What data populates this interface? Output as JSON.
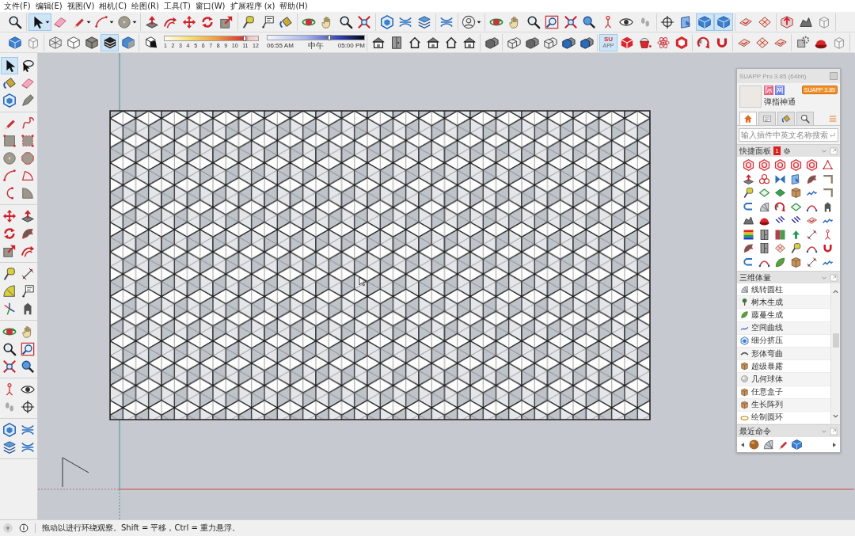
{
  "menu": [
    "文件(F)",
    "编辑(E)",
    "视图(V)",
    "相机(C)",
    "绘图(R)",
    "工具(T)",
    "窗口(W)",
    "扩展程序 (x)",
    "帮助(H)"
  ],
  "toolbar_1": [
    [
      {
        "kind": "magnifier",
        "selected": false
      }
    ],
    [
      {
        "kind": "cursor",
        "selected": true,
        "dropdown": true
      },
      {
        "kind": "eraser",
        "selected": false
      },
      {
        "kind": "pencil",
        "selected": false,
        "dropdown": true
      },
      {
        "kind": "arc",
        "selected": false,
        "dropdown": true
      },
      {
        "kind": "disc",
        "selected": false,
        "dropdown": true
      }
    ],
    [
      {
        "kind": "pushpull",
        "selected": false
      },
      {
        "kind": "swirl",
        "selected": false
      },
      {
        "kind": "move",
        "selected": false
      },
      {
        "kind": "rotate",
        "selected": false
      },
      {
        "kind": "scale",
        "selected": false
      }
    ],
    [
      {
        "kind": "tape",
        "selected": false
      },
      {
        "kind": "label",
        "selected": false
      },
      {
        "kind": "bucket",
        "selected": false
      }
    ],
    [
      {
        "kind": "orbit",
        "selected": false
      },
      {
        "kind": "hand",
        "selected": false
      },
      {
        "kind": "magnifier",
        "selected": false
      },
      {
        "kind": "extents",
        "selected": false
      }
    ],
    [
      {
        "kind": "hexcube",
        "selected": false
      },
      {
        "kind": "waves",
        "selected": false
      },
      {
        "kind": "layers",
        "selected": false
      }
    ],
    [
      {
        "kind": "waves",
        "selected": false
      }
    ],
    [
      {
        "kind": "user",
        "selected": false,
        "dropdown": true
      }
    ],
    [
      {
        "kind": "orbit",
        "selected": false
      },
      {
        "kind": "hand",
        "selected": false
      },
      {
        "kind": "magnifier",
        "selected": false
      },
      {
        "kind": "zoomwin",
        "selected": false
      },
      {
        "kind": "extents",
        "selected": false
      },
      {
        "kind": "previous",
        "selected": false
      },
      {
        "kind": "figure",
        "selected": false
      },
      {
        "kind": "eye",
        "selected": false
      },
      {
        "kind": "feet",
        "selected": false
      }
    ],
    [
      {
        "kind": "crosshair",
        "selected": false
      },
      {
        "kind": "section",
        "selected": false
      },
      {
        "kind": "isocube",
        "selected": true
      },
      {
        "kind": "isocube",
        "selected": true
      }
    ],
    [
      {
        "kind": "tile",
        "selected": false
      },
      {
        "kind": "grid",
        "selected": false
      }
    ],
    [
      {
        "kind": "cubearrow",
        "selected": false
      },
      {
        "kind": "mound",
        "selected": false
      },
      {
        "kind": "outline",
        "selected": false
      }
    ]
  ],
  "toolbar_2": {
    "groups_before": [
      [
        {
          "kind": "isocube",
          "selected": false
        },
        {
          "kind": "outline",
          "selected": false
        }
      ],
      [
        {
          "kind": "wirebox",
          "selected": false
        },
        {
          "kind": "whitebox",
          "selected": false
        },
        {
          "kind": "graybox",
          "selected": false
        },
        {
          "kind": "stripes",
          "selected": true
        },
        {
          "kind": "skybox",
          "selected": false
        }
      ]
    ],
    "shadow_toggle": {
      "kind": "shadow",
      "selected": false
    },
    "month_slider": {
      "ticks": [
        "1",
        "2",
        "3",
        "4",
        "5",
        "6",
        "7",
        "8",
        "9",
        "10",
        "11",
        "12"
      ],
      "level": 0.86
    },
    "time_slider": {
      "labels": [
        "06:55 AM",
        "中午",
        "05:00 PM"
      ],
      "level": 0.64
    },
    "groups_after": [
      [
        {
          "kind": "roofhouse",
          "selected": false
        },
        {
          "kind": "door",
          "selected": false
        },
        {
          "kind": "house",
          "selected": false
        },
        {
          "kind": "roofhouse",
          "selected": false
        },
        {
          "kind": "house",
          "selected": false
        },
        {
          "kind": "roofhouse",
          "selected": false
        }
      ],
      [
        {
          "kind": "boxes",
          "selected": false
        }
      ],
      [
        {
          "kind": "wireboxes",
          "selected": false
        },
        {
          "kind": "boxes",
          "selected": false
        },
        {
          "kind": "wireboxes",
          "selected": false
        },
        {
          "kind": "skyboxes",
          "selected": false
        },
        {
          "kind": "skyboxes",
          "selected": false
        }
      ],
      [
        {
          "kind": "su",
          "label": "SU",
          "sublabel": "APP",
          "selected": true
        },
        {
          "kind": "mcube",
          "selected": false
        },
        {
          "kind": "redbucket",
          "selected": false
        },
        {
          "kind": "atom",
          "selected": false
        },
        {
          "kind": "redhex",
          "selected": false
        }
      ],
      [
        {
          "kind": "curl",
          "selected": false
        },
        {
          "kind": "magnet",
          "selected": false
        }
      ],
      [
        {
          "kind": "tile",
          "selected": false
        },
        {
          "kind": "grid",
          "selected": false
        },
        {
          "kind": "tile",
          "selected": false
        }
      ],
      [
        {
          "kind": "gearbox",
          "selected": false
        },
        {
          "kind": "redball",
          "selected": false
        },
        {
          "kind": "outline",
          "selected": false
        }
      ]
    ]
  },
  "side_toolbar": [
    [
      {
        "kind": "cursor",
        "selected": true
      },
      {
        "kind": "lasso",
        "selected": false
      },
      {
        "kind": "bucket",
        "selected": false
      },
      {
        "kind": "eraser",
        "selected": false
      },
      {
        "kind": "hexcube",
        "selected": false
      },
      {
        "kind": "tag",
        "selected": false
      }
    ],
    [
      {
        "kind": "pencil",
        "selected": false
      },
      {
        "kind": "squiggle",
        "selected": false
      },
      {
        "kind": "rect",
        "selected": false
      },
      {
        "kind": "rotrect",
        "selected": false
      },
      {
        "kind": "disc",
        "selected": false
      },
      {
        "kind": "octagon",
        "selected": false
      },
      {
        "kind": "arc",
        "selected": false
      },
      {
        "kind": "pie",
        "selected": false
      },
      {
        "kind": "arc3",
        "selected": false
      },
      {
        "kind": "quarter",
        "selected": false
      }
    ],
    [
      {
        "kind": "move",
        "selected": false
      },
      {
        "kind": "pushpull",
        "selected": false
      },
      {
        "kind": "rotate",
        "selected": false
      },
      {
        "kind": "shell",
        "selected": false
      },
      {
        "kind": "scale",
        "selected": false
      },
      {
        "kind": "swirl",
        "selected": false
      }
    ],
    [
      {
        "kind": "tape",
        "selected": false
      },
      {
        "kind": "dimension",
        "selected": false
      },
      {
        "kind": "protractor",
        "selected": false
      },
      {
        "kind": "label",
        "selected": false
      },
      {
        "kind": "axes",
        "selected": false
      },
      {
        "kind": "block",
        "selected": false
      }
    ],
    [
      {
        "kind": "orbit",
        "selected": false
      },
      {
        "kind": "hand",
        "selected": false
      },
      {
        "kind": "magnifier",
        "selected": false
      },
      {
        "kind": "zoomwin",
        "selected": false
      },
      {
        "kind": "extents",
        "selected": false
      },
      {
        "kind": "previous",
        "selected": false
      }
    ],
    [
      {
        "kind": "figure",
        "selected": false
      },
      {
        "kind": "eye",
        "selected": false
      },
      {
        "kind": "feet",
        "selected": false
      },
      {
        "kind": "crosshair",
        "selected": false
      }
    ],
    [
      {
        "kind": "hexcube",
        "selected": false
      },
      {
        "kind": "waves",
        "selected": false
      },
      {
        "kind": "layers",
        "selected": false
      },
      {
        "kind": "waves",
        "selected": false
      }
    ]
  ],
  "plugin_panel": {
    "title": "SUAPP Pro 3.85 (64bit)",
    "user": {
      "badges": [
        {
          "text": "际",
          "color": "#e4607e"
        },
        {
          "text": "网",
          "color": "#6f7fe0"
        }
      ],
      "name": "弹指神通",
      "version_button": "SUAPP 3.85"
    },
    "tabs": [
      {
        "kind": "home",
        "selected": true
      },
      {
        "kind": "list",
        "selected": false
      },
      {
        "kind": "bucket",
        "selected": false
      },
      {
        "kind": "search",
        "selected": false
      }
    ],
    "search": {
      "placeholder": "输入插件中英文名称搜索"
    },
    "quick_panel": {
      "title": "快捷面板",
      "badge": "1"
    },
    "category": {
      "title": "三维体量",
      "items": [
        "线转圆柱",
        "树木生成",
        "藤蔓生成",
        "空间曲线",
        "细分挤压",
        "形体弯曲",
        "超级暴露",
        "几何球体",
        "任意盒子",
        "生长阵列",
        "绘制圆环"
      ]
    },
    "recent": {
      "title": "最近命令"
    }
  },
  "status_bar": {
    "text": "拖动以进行环绕观察。Shift = 平移，Ctrl = 重力悬浮。"
  }
}
